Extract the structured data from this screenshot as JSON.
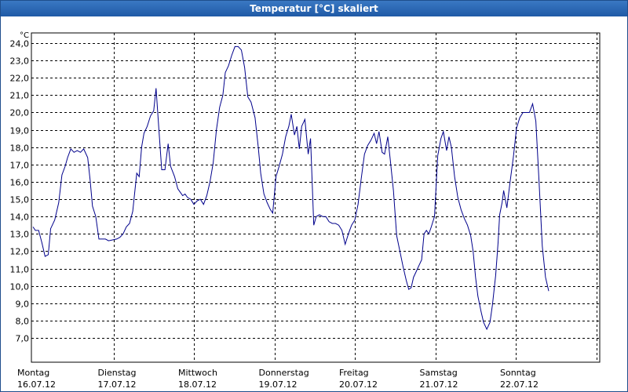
{
  "window": {
    "title": "Temperatur [°C] skaliert"
  },
  "chart_data": {
    "type": "line",
    "title": "Temperatur [°C] skaliert",
    "ylabel_unit": "°C",
    "ylim": [
      7.0,
      24.0
    ],
    "y_ticks": [
      "24,0",
      "23,0",
      "22,0",
      "21,0",
      "20,0",
      "19,0",
      "18,0",
      "17,0",
      "16,0",
      "15,0",
      "14,0",
      "13,0",
      "12,0",
      "11,0",
      "10,0",
      "9,0",
      "8,0",
      "7,0"
    ],
    "x_ticks": [
      {
        "day": "Montag",
        "date": "16.07.12"
      },
      {
        "day": "Dienstag",
        "date": "17.07.12"
      },
      {
        "day": "Mittwoch",
        "date": "18.07.12"
      },
      {
        "day": "Donnerstag",
        "date": "19.07.12"
      },
      {
        "day": "Freitag",
        "date": "20.07.12"
      },
      {
        "day": "Samstag",
        "date": "21.07.12"
      },
      {
        "day": "Sonntag",
        "date": "22.07.12"
      }
    ],
    "xlim_days": [
      0,
      7.1
    ],
    "grid": true,
    "series": [
      {
        "color": "#00008b",
        "points": [
          [
            0.0,
            13.4
          ],
          [
            0.03,
            13.2
          ],
          [
            0.07,
            13.2
          ],
          [
            0.11,
            12.5
          ],
          [
            0.15,
            11.7
          ],
          [
            0.19,
            11.8
          ],
          [
            0.22,
            13.3
          ],
          [
            0.27,
            13.8
          ],
          [
            0.32,
            14.8
          ],
          [
            0.36,
            16.4
          ],
          [
            0.4,
            16.9
          ],
          [
            0.43,
            17.4
          ],
          [
            0.47,
            17.9
          ],
          [
            0.51,
            17.7
          ],
          [
            0.55,
            17.8
          ],
          [
            0.59,
            17.7
          ],
          [
            0.63,
            17.9
          ],
          [
            0.68,
            17.4
          ],
          [
            0.71,
            16.1
          ],
          [
            0.74,
            14.6
          ],
          [
            0.78,
            14.0
          ],
          [
            0.82,
            12.7
          ],
          [
            0.9,
            12.7
          ],
          [
            0.94,
            12.6
          ],
          [
            1.04,
            12.7
          ],
          [
            1.08,
            12.8
          ],
          [
            1.12,
            13.0
          ],
          [
            1.16,
            13.4
          ],
          [
            1.2,
            13.6
          ],
          [
            1.24,
            14.3
          ],
          [
            1.29,
            16.5
          ],
          [
            1.32,
            16.3
          ],
          [
            1.35,
            18.0
          ],
          [
            1.38,
            18.8
          ],
          [
            1.42,
            19.2
          ],
          [
            1.46,
            19.8
          ],
          [
            1.5,
            20.1
          ],
          [
            1.53,
            21.4
          ],
          [
            1.57,
            18.7
          ],
          [
            1.6,
            16.7
          ],
          [
            1.64,
            16.7
          ],
          [
            1.68,
            18.2
          ],
          [
            1.71,
            16.9
          ],
          [
            1.76,
            16.3
          ],
          [
            1.8,
            15.6
          ],
          [
            1.83,
            15.4
          ],
          [
            1.86,
            15.2
          ],
          [
            1.89,
            15.3
          ],
          [
            1.92,
            15.1
          ],
          [
            1.96,
            15.0
          ],
          [
            2.0,
            14.7
          ],
          [
            2.04,
            14.9
          ],
          [
            2.08,
            15.0
          ],
          [
            2.12,
            14.7
          ],
          [
            2.16,
            15.2
          ],
          [
            2.2,
            16.0
          ],
          [
            2.24,
            17.1
          ],
          [
            2.28,
            19.0
          ],
          [
            2.32,
            20.3
          ],
          [
            2.36,
            21.0
          ],
          [
            2.39,
            22.3
          ],
          [
            2.43,
            22.7
          ],
          [
            2.47,
            23.3
          ],
          [
            2.51,
            23.8
          ],
          [
            2.55,
            23.8
          ],
          [
            2.59,
            23.6
          ],
          [
            2.63,
            22.6
          ],
          [
            2.67,
            20.9
          ],
          [
            2.71,
            20.6
          ],
          [
            2.76,
            19.7
          ],
          [
            2.8,
            18.0
          ],
          [
            2.83,
            16.5
          ],
          [
            2.87,
            15.3
          ],
          [
            2.91,
            14.8
          ],
          [
            2.95,
            14.4
          ],
          [
            2.98,
            14.2
          ],
          [
            3.02,
            16.3
          ],
          [
            3.06,
            16.9
          ],
          [
            3.1,
            17.6
          ],
          [
            3.14,
            18.6
          ],
          [
            3.18,
            19.2
          ],
          [
            3.21,
            19.9
          ],
          [
            3.25,
            18.7
          ],
          [
            3.28,
            19.2
          ],
          [
            3.31,
            17.9
          ],
          [
            3.34,
            19.2
          ],
          [
            3.38,
            19.6
          ],
          [
            3.42,
            17.6
          ],
          [
            3.45,
            18.5
          ],
          [
            3.49,
            13.5
          ],
          [
            3.52,
            14.0
          ],
          [
            3.56,
            14.1
          ],
          [
            3.6,
            14.0
          ],
          [
            3.64,
            14.0
          ],
          [
            3.68,
            13.7
          ],
          [
            3.72,
            13.6
          ],
          [
            3.76,
            13.6
          ],
          [
            3.8,
            13.5
          ],
          [
            3.84,
            13.2
          ],
          [
            3.88,
            12.4
          ],
          [
            3.92,
            13.0
          ],
          [
            3.96,
            13.5
          ],
          [
            4.0,
            13.8
          ],
          [
            4.04,
            14.7
          ],
          [
            4.08,
            16.2
          ],
          [
            4.12,
            17.6
          ],
          [
            4.16,
            18.1
          ],
          [
            4.2,
            18.4
          ],
          [
            4.24,
            18.8
          ],
          [
            4.27,
            18.2
          ],
          [
            4.3,
            18.9
          ],
          [
            4.34,
            17.7
          ],
          [
            4.37,
            17.6
          ],
          [
            4.41,
            18.6
          ],
          [
            4.44,
            17.3
          ],
          [
            4.48,
            15.5
          ],
          [
            4.52,
            12.9
          ],
          [
            4.56,
            12.0
          ],
          [
            4.6,
            11.1
          ],
          [
            4.64,
            10.3
          ],
          [
            4.67,
            9.8
          ],
          [
            4.7,
            9.9
          ],
          [
            4.73,
            10.5
          ],
          [
            4.76,
            10.8
          ],
          [
            4.8,
            11.2
          ],
          [
            4.83,
            11.5
          ],
          [
            4.86,
            13.0
          ],
          [
            4.89,
            13.2
          ],
          [
            4.92,
            13.0
          ],
          [
            4.95,
            13.4
          ],
          [
            4.99,
            14.0
          ],
          [
            5.03,
            17.5
          ],
          [
            5.07,
            18.5
          ],
          [
            5.1,
            18.9
          ],
          [
            5.14,
            17.8
          ],
          [
            5.17,
            18.6
          ],
          [
            5.2,
            18.0
          ],
          [
            5.24,
            16.3
          ],
          [
            5.28,
            15.1
          ],
          [
            5.32,
            14.4
          ],
          [
            5.36,
            13.9
          ],
          [
            5.4,
            13.5
          ],
          [
            5.44,
            12.9
          ],
          [
            5.47,
            12.0
          ],
          [
            5.5,
            10.5
          ],
          [
            5.53,
            9.4
          ],
          [
            5.57,
            8.5
          ],
          [
            5.6,
            7.9
          ],
          [
            5.64,
            7.5
          ],
          [
            5.68,
            7.9
          ],
          [
            5.71,
            8.9
          ],
          [
            5.75,
            10.6
          ],
          [
            5.78,
            12.5
          ],
          [
            5.8,
            14.1
          ],
          [
            5.83,
            14.8
          ],
          [
            5.85,
            15.5
          ],
          [
            5.89,
            14.5
          ],
          [
            5.93,
            16.0
          ],
          [
            5.97,
            17.4
          ],
          [
            6.01,
            19.1
          ],
          [
            6.05,
            19.7
          ],
          [
            6.09,
            20.0
          ],
          [
            6.13,
            20.0
          ],
          [
            6.17,
            20.0
          ],
          [
            6.21,
            20.5
          ],
          [
            6.25,
            19.5
          ],
          [
            6.29,
            16.0
          ],
          [
            6.33,
            12.3
          ],
          [
            6.37,
            10.5
          ],
          [
            6.41,
            9.7
          ]
        ]
      }
    ]
  }
}
